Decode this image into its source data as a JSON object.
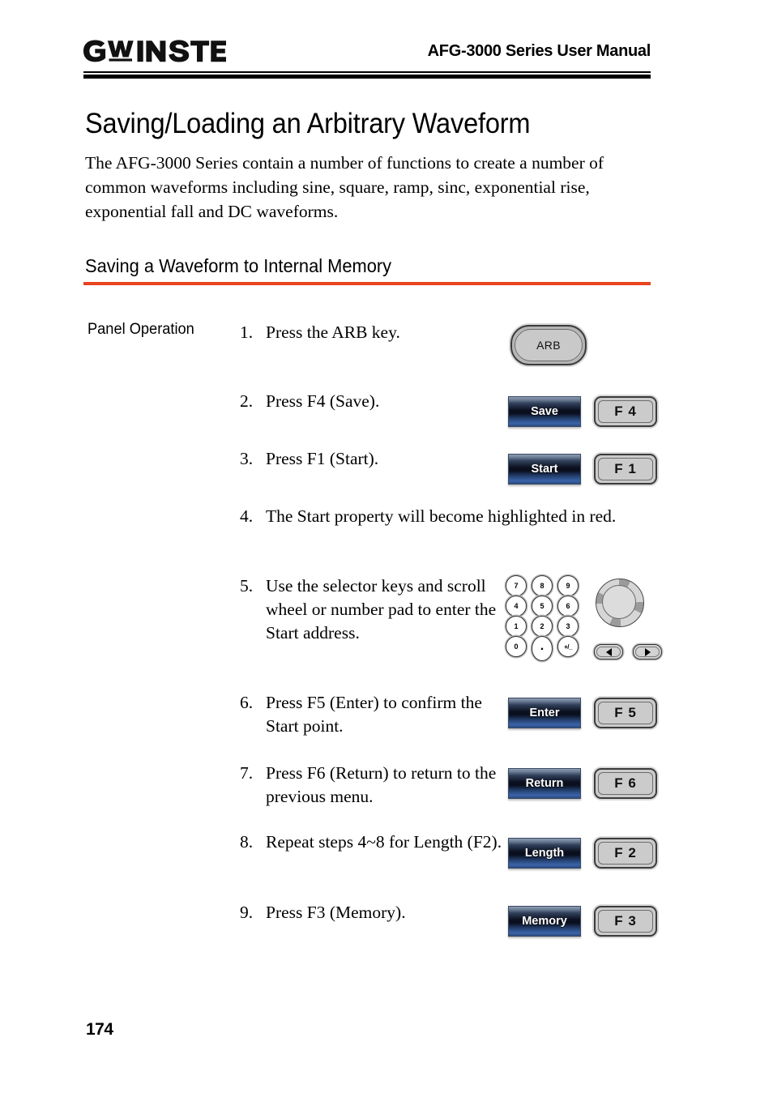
{
  "header": {
    "logo_text": "GW INSTEK",
    "logo_icon": "gwinstek-logo",
    "manual_title": "AFG-3000 Series User Manual"
  },
  "page_title": "Saving/Loading an Arbitrary Waveform",
  "intro_paragraph": "The AFG-3000 Series contain a number of functions to create a number of common waveforms including sine, square, ramp, sinc, exponential rise, exponential fall and DC waveforms.",
  "section_heading": "Saving a Waveform to Internal Memory",
  "panel_operation_label": "Panel Operation",
  "steps": [
    {
      "num": "1.",
      "text": "Press the ARB key."
    },
    {
      "num": "2.",
      "text": "Press F4 (Save)."
    },
    {
      "num": "3.",
      "text": "Press F1 (Start)."
    },
    {
      "num": "4.",
      "text": "The Start property will become highlighted in red."
    },
    {
      "num": "5.",
      "text": "Use the selector keys and scroll wheel or number pad to enter the Start address."
    },
    {
      "num": "6.",
      "text": "Press F5 (Enter) to confirm the Start point."
    },
    {
      "num": "7.",
      "text": "Press F6 (Return) to return to the previous menu."
    },
    {
      "num": "8.",
      "text": "Repeat steps 4~8 for Length (F2)."
    },
    {
      "num": "9.",
      "text": "Press F3 (Memory)."
    }
  ],
  "keys": {
    "arb": "ARB",
    "softkeys": [
      {
        "label": "Save",
        "fkey": "F 4"
      },
      {
        "label": "Start",
        "fkey": "F 1"
      },
      {
        "label": "Enter",
        "fkey": "F 5"
      },
      {
        "label": "Return",
        "fkey": "F 6"
      },
      {
        "label": "Length",
        "fkey": "F 2"
      },
      {
        "label": "Memory",
        "fkey": "F 3"
      }
    ],
    "numpad": [
      "7",
      "8",
      "9",
      "4",
      "5",
      "6",
      "1",
      "2",
      "3",
      "0",
      ".",
      "+/_"
    ],
    "wheel_name": "scroll-wheel",
    "arrow_left": "◀",
    "arrow_right": "▶"
  },
  "page_number": "174",
  "colors": {
    "accent_rule": "#E8441F",
    "softkey_text": "#FFFFFF",
    "rule_black": "#000000"
  }
}
